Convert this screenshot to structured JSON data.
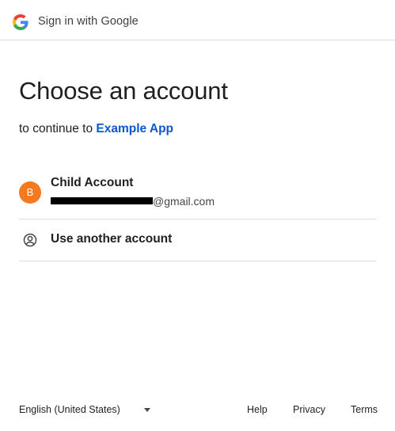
{
  "header": {
    "title": "Sign in with Google",
    "logo_icon": "google-g-logo",
    "colors": {
      "blue": "#4285F4",
      "red": "#EA4335",
      "yellow": "#FBBC05",
      "green": "#34A853"
    }
  },
  "main": {
    "title": "Choose an account",
    "subtitle_prefix": "to continue to",
    "app_name": "Example App",
    "link_color": "#0b57d0"
  },
  "accounts": [
    {
      "avatar_letter": "B",
      "avatar_color": "#f4791f",
      "name": "Child Account",
      "email_suffix": "@gmail.com"
    }
  ],
  "another_account": {
    "label": "Use another account",
    "icon": "account-circle-icon"
  },
  "footer": {
    "language": "English (United States)",
    "language_icon": "caret-down-icon",
    "links": {
      "help": "Help",
      "privacy": "Privacy",
      "terms": "Terms"
    }
  }
}
